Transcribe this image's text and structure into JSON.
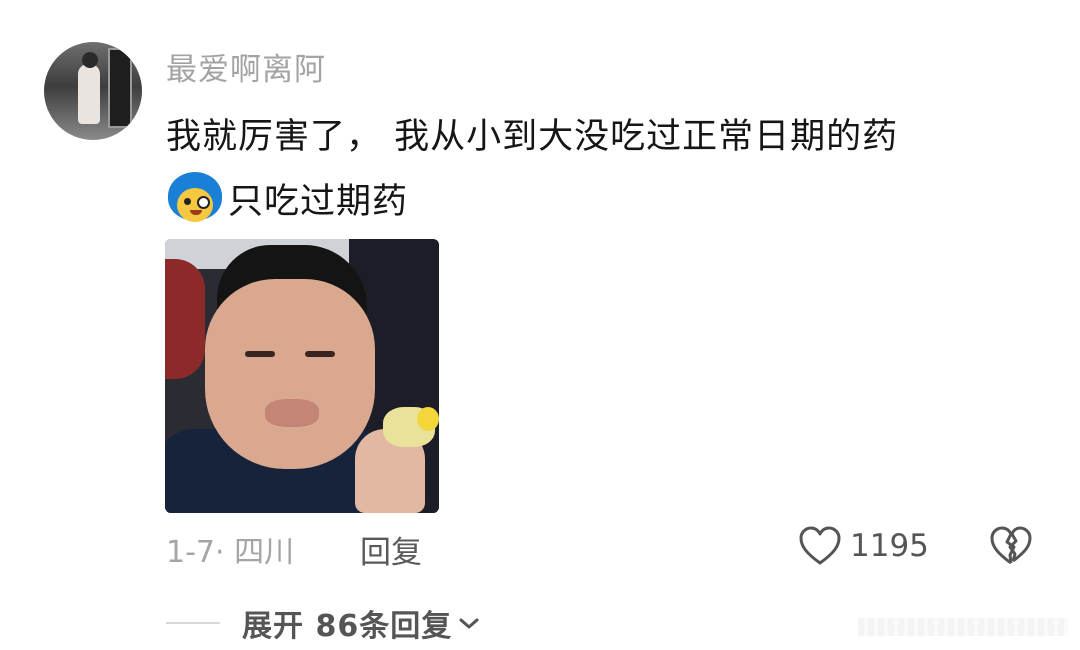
{
  "comment": {
    "username": "最爱啊离阿",
    "text_line1": "我就厉害了， 我从小到大没吃过正常日期的药",
    "emoji_icon": "cartoon-blue-hair-face-icon",
    "text_line2": "只吃过期药",
    "date_location": "1-7· 四川",
    "reply_label": "回复",
    "like_count": "1195",
    "expand_replies_label": "展开 86条回复"
  },
  "icons": {
    "like": "heart-outline-icon",
    "dislike": "broken-heart-icon",
    "expand": "chevron-down-icon"
  },
  "colors": {
    "username": "#a3a3a3",
    "body_text": "#161616",
    "meta_text": "#a5a5a5"
  }
}
